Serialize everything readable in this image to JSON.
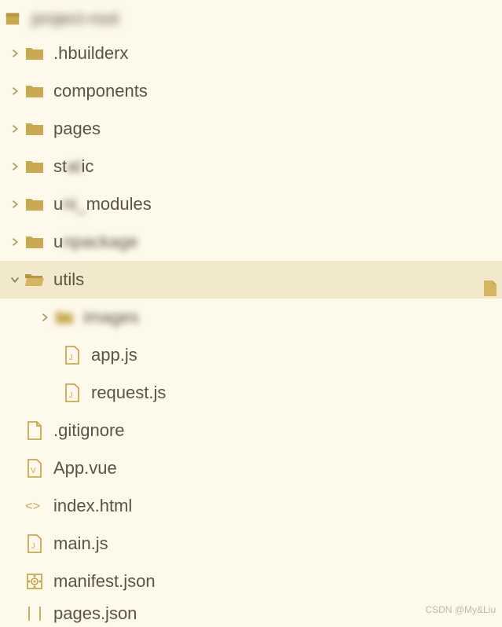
{
  "root": {
    "label": "project-root"
  },
  "tree": [
    {
      "id": "hbuilderx",
      "label": ".hbuilderx",
      "type": "folder",
      "expanded": false,
      "indent": 1
    },
    {
      "id": "components",
      "label": "components",
      "type": "folder",
      "expanded": false,
      "indent": 1
    },
    {
      "id": "pages",
      "label": "pages",
      "type": "folder",
      "expanded": false,
      "indent": 1
    },
    {
      "id": "static",
      "label": "static",
      "type": "folder",
      "expanded": false,
      "indent": 1,
      "partial_blur": true
    },
    {
      "id": "uni_modules",
      "label": "uni_modules",
      "type": "folder",
      "expanded": false,
      "indent": 1,
      "partial_blur": true
    },
    {
      "id": "unpackage",
      "label": "unpackage",
      "type": "folder",
      "expanded": false,
      "indent": 1,
      "partial_blur": true
    },
    {
      "id": "utils",
      "label": "utils",
      "type": "folder",
      "expanded": true,
      "indent": 1,
      "selected": true
    },
    {
      "id": "utils-sub",
      "label": "images",
      "type": "folder",
      "expanded": false,
      "indent": 2,
      "blurred": true
    },
    {
      "id": "app-js",
      "label": "app.js",
      "type": "file-js",
      "indent": 3
    },
    {
      "id": "request-js",
      "label": "request.js",
      "type": "file-js",
      "indent": 3
    },
    {
      "id": "gitignore",
      "label": ".gitignore",
      "type": "file",
      "indent": 1
    },
    {
      "id": "app-vue",
      "label": "App.vue",
      "type": "file-vue",
      "indent": 1
    },
    {
      "id": "index-html",
      "label": "index.html",
      "type": "file-html",
      "indent": 1
    },
    {
      "id": "main-js",
      "label": "main.js",
      "type": "file-js",
      "indent": 1
    },
    {
      "id": "manifest-json",
      "label": "manifest.json",
      "type": "file-json",
      "indent": 1
    },
    {
      "id": "pages-json",
      "label": "pages.json",
      "type": "file-json",
      "indent": 1
    }
  ],
  "watermark": "CSDN @My&Liu",
  "colors": {
    "bg": "#fdf9eb",
    "selected": "#f2e8cb",
    "folder": "#c9a94f",
    "folder_open": "#d4b560",
    "text": "#5a5445",
    "chevron": "#a89a6a"
  }
}
